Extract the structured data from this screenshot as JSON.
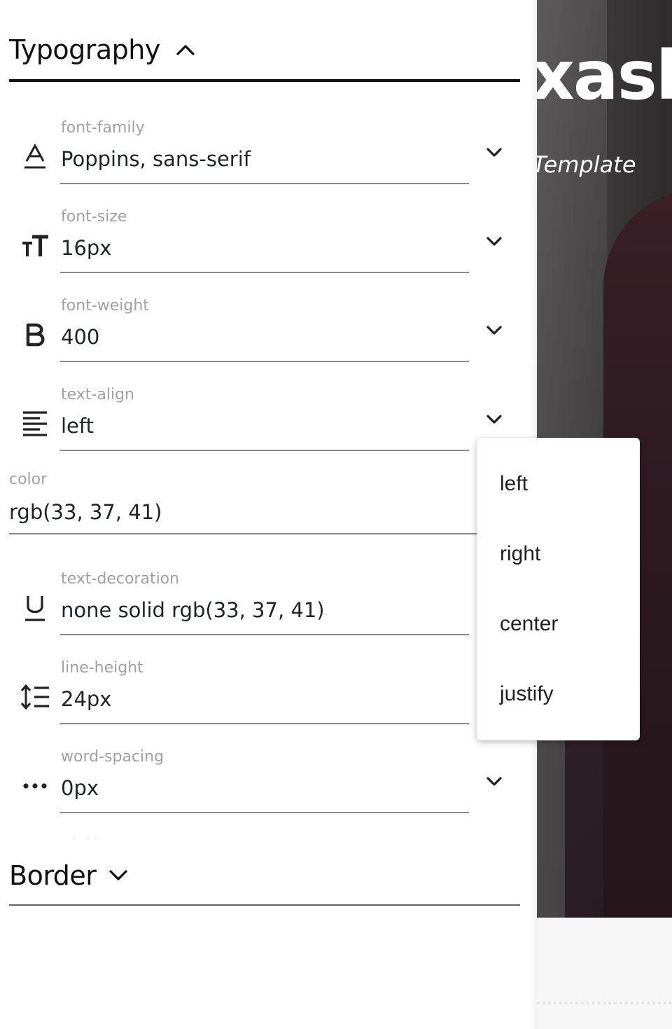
{
  "preview": {
    "title_fragment": "xasl",
    "subtitle_fragment": "Template"
  },
  "typography": {
    "title": "Typography",
    "fields": [
      {
        "label": "font-family",
        "value": "Poppins, sans-serif",
        "icon": "font-family-icon"
      },
      {
        "label": "font-size",
        "value": "16px",
        "icon": "font-size-icon"
      },
      {
        "label": "font-weight",
        "value": "400",
        "icon": "bold-icon"
      },
      {
        "label": "text-align",
        "value": "left",
        "icon": "align-left-icon"
      }
    ],
    "color": {
      "label": "color",
      "value": "rgb(33, 37, 41)"
    },
    "fields2": [
      {
        "label": "text-decoration",
        "value": "none solid rgb(33, 37, 41)",
        "icon": "underline-icon"
      },
      {
        "label": "line-height",
        "value": "24px",
        "icon": "line-height-icon"
      },
      {
        "label": "word-spacing",
        "value": "0px",
        "icon": "word-spacing-icon"
      }
    ]
  },
  "border": {
    "title": "Border"
  },
  "align_menu": {
    "options": [
      "left",
      "right",
      "center",
      "justify"
    ]
  }
}
